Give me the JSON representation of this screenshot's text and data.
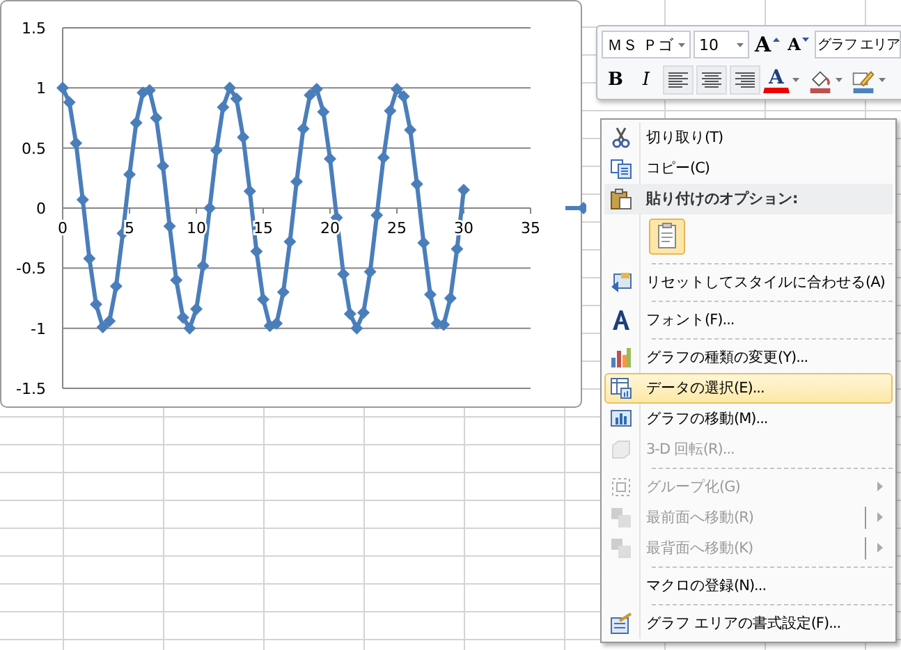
{
  "chart": {
    "chart_data": {
      "type": "line",
      "grid": true,
      "x": [
        0,
        0.5,
        1,
        1.5,
        2,
        2.5,
        3,
        3.5,
        4,
        4.5,
        5,
        5.5,
        6,
        6.5,
        7,
        7.5,
        8,
        8.5,
        9,
        9.5,
        10,
        10.5,
        11,
        11.5,
        12,
        12.5,
        13,
        13.5,
        14,
        14.5,
        15,
        15.5,
        16,
        16.5,
        17,
        17.5,
        18,
        18.5,
        19,
        19.5,
        20,
        20.5,
        21,
        21.5,
        22,
        22.5,
        23,
        23.5,
        24,
        24.5,
        25,
        25.5,
        26,
        26.5,
        27,
        27.5,
        28,
        28.5,
        29,
        29.5,
        30
      ],
      "series": [
        {
          "color": "#4a7ebb",
          "marker": "diamond",
          "values": [
            1,
            0.88,
            0.54,
            0.07,
            -0.42,
            -0.8,
            -0.99,
            -0.94,
            -0.65,
            -0.21,
            0.28,
            0.71,
            0.96,
            0.98,
            0.75,
            0.35,
            -0.15,
            -0.6,
            -0.91,
            -1,
            -0.84,
            -0.48,
            0,
            0.48,
            0.84,
            1,
            0.91,
            0.59,
            0.14,
            -0.36,
            -0.76,
            -0.98,
            -0.96,
            -0.7,
            -0.28,
            0.22,
            0.66,
            0.94,
            0.99,
            0.8,
            0.41,
            -0.08,
            -0.55,
            -0.88,
            -1,
            -0.87,
            -0.53,
            -0.06,
            0.42,
            0.81,
            0.99,
            0.93,
            0.65,
            0.2,
            -0.29,
            -0.72,
            -0.96,
            -0.97,
            -0.75,
            -0.34,
            0.15
          ]
        }
      ],
      "xlim": [
        0,
        35
      ],
      "ylim": [
        -1.5,
        1.5
      ],
      "xticks": [
        0,
        5,
        10,
        15,
        20,
        25,
        30,
        35
      ],
      "yticks": [
        -1.5,
        -1,
        -0.5,
        0,
        0.5,
        1,
        1.5
      ]
    }
  },
  "mini_toolbar": {
    "font": "ＭＳ Ｐゴ",
    "size": "10",
    "grow_label": "A",
    "shrink_label": "A",
    "element": "グラフ エリア",
    "bold_label": "B",
    "italic_label": "I",
    "font_color_label": "A"
  },
  "context_menu": {
    "items": [
      {
        "kind": "item",
        "label": "切り取り(T)",
        "disabled": false,
        "selected": false,
        "submenu": false
      },
      {
        "kind": "item",
        "label": "コピー(C)",
        "disabled": false,
        "selected": false,
        "submenu": false
      },
      {
        "kind": "header",
        "label": "貼り付けのオプション:"
      },
      {
        "kind": "paste_options"
      },
      {
        "kind": "separator"
      },
      {
        "kind": "item",
        "label": "リセットしてスタイルに合わせる(A)",
        "disabled": false,
        "selected": false,
        "submenu": false
      },
      {
        "kind": "separator"
      },
      {
        "kind": "item",
        "label": "フォント(F)...",
        "disabled": false,
        "selected": false,
        "submenu": false
      },
      {
        "kind": "separator"
      },
      {
        "kind": "item",
        "label": "グラフの種類の変更(Y)...",
        "disabled": false,
        "selected": false,
        "submenu": false
      },
      {
        "kind": "item",
        "label": "データの選択(E)...",
        "disabled": false,
        "selected": true,
        "submenu": false
      },
      {
        "kind": "item",
        "label": "グラフの移動(M)...",
        "disabled": false,
        "selected": false,
        "submenu": false
      },
      {
        "kind": "item",
        "label": "3-D 回転(R)...",
        "disabled": true,
        "selected": false,
        "submenu": false
      },
      {
        "kind": "separator"
      },
      {
        "kind": "item",
        "label": "グループ化(G)",
        "disabled": true,
        "selected": false,
        "submenu": true
      },
      {
        "kind": "item",
        "label": "最前面へ移動(R)",
        "disabled": true,
        "selected": false,
        "submenu": true
      },
      {
        "kind": "item",
        "label": "最背面へ移動(K)",
        "disabled": true,
        "selected": false,
        "submenu": true
      },
      {
        "kind": "separator"
      },
      {
        "kind": "item",
        "label": "マクロの登録(N)...",
        "disabled": false,
        "selected": false,
        "submenu": false
      },
      {
        "kind": "separator"
      },
      {
        "kind": "item",
        "label": "グラフ エリアの書式設定(F)...",
        "disabled": false,
        "selected": false,
        "submenu": false
      }
    ]
  }
}
